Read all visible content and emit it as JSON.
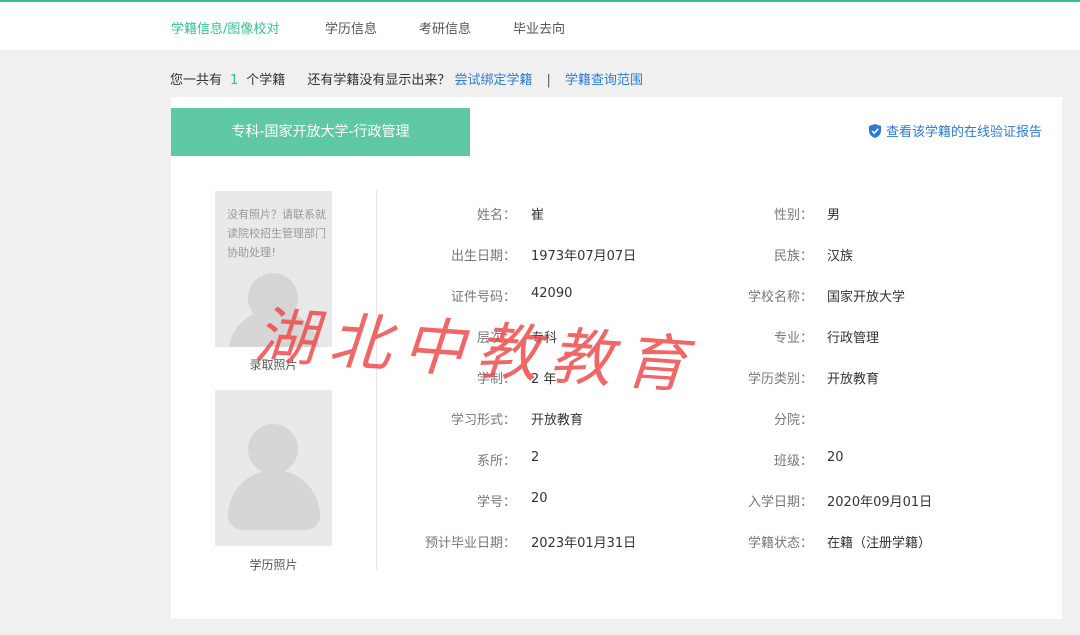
{
  "nav": {
    "tabs": [
      {
        "label": "学籍信息/图像校对",
        "active": true
      },
      {
        "label": "学历信息",
        "active": false
      },
      {
        "label": "考研信息",
        "active": false
      },
      {
        "label": "毕业去向",
        "active": false
      }
    ]
  },
  "summary": {
    "prefix": "您一共有",
    "count": "1",
    "suffix": "个学籍",
    "question": "还有学籍没有显示出来？",
    "bind_link": "尝试绑定学籍",
    "separator": "|",
    "scope_link": "学籍查询范围"
  },
  "record": {
    "title": "专科-国家开放大学-行政管理",
    "verify_link": "查看该学籍的在线验证报告",
    "photo_note": "没有照片？请联系就读院校招生管理部门协助处理！",
    "admission_photo_label": "录取照片",
    "education_photo_label": "学历照片",
    "fields_left": [
      {
        "label": "姓名：",
        "value": "崔"
      },
      {
        "label": "出生日期：",
        "value": "1973年07月07日"
      },
      {
        "label": "证件号码：",
        "value": "42090"
      },
      {
        "label": "层次：",
        "value": "专科"
      },
      {
        "label": "学制：",
        "value": "2 年"
      },
      {
        "label": "学习形式：",
        "value": "开放教育"
      },
      {
        "label": "系所：",
        "value": "2"
      },
      {
        "label": "学号：",
        "value": "20"
      },
      {
        "label": "预计毕业日期：",
        "value": "2023年01月31日"
      }
    ],
    "fields_right": [
      {
        "label": "性别：",
        "value": "男"
      },
      {
        "label": "民族：",
        "value": "汉族"
      },
      {
        "label": "学校名称：",
        "value": "国家开放大学"
      },
      {
        "label": "专业：",
        "value": "行政管理"
      },
      {
        "label": "学历类别：",
        "value": "开放教育"
      },
      {
        "label": "分院：",
        "value": ""
      },
      {
        "label": "班级：",
        "value": "20"
      },
      {
        "label": "入学日期：",
        "value": "2020年09月01日"
      },
      {
        "label": "学籍状态：",
        "value": "在籍（注册学籍）"
      }
    ]
  },
  "watermark": "湖北中教教育",
  "colors": {
    "accent": "#35c192",
    "title_bg": "#5fc9a3",
    "link": "#2d7bd6",
    "watermark": "#ee4646"
  },
  "icons": {
    "verify": "shield-check-icon",
    "avatar": "avatar-placeholder-icon"
  }
}
